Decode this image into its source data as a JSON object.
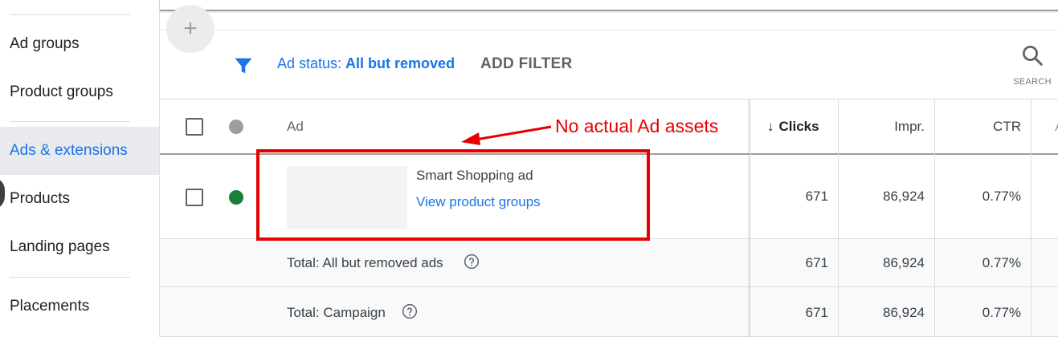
{
  "sidebar": {
    "items": [
      {
        "label": "Ad groups"
      },
      {
        "label": "Product groups"
      },
      {
        "label": "Ads & extensions"
      },
      {
        "label": "Products"
      },
      {
        "label": "Landing pages"
      },
      {
        "label": "Placements"
      }
    ]
  },
  "toolbar": {
    "add_symbol": "+",
    "filter_prefix": "Ad status: ",
    "filter_value": "All but removed",
    "add_filter": "ADD FILTER",
    "search_label": "SEARCH"
  },
  "table": {
    "headers": {
      "ad": "Ad",
      "clicks": "Clicks",
      "impr": "Impr.",
      "ctr": "CTR",
      "partial": "A"
    },
    "sort_arrow": "↓",
    "ad_row": {
      "title": "Smart Shopping ad",
      "link": "View product groups",
      "clicks": "671",
      "impr": "86,924",
      "ctr": "0.77%",
      "status_color": "#188038"
    },
    "totals": [
      {
        "label": "Total: All but removed ads",
        "clicks": "671",
        "impr": "86,924",
        "ctr": "0.77%"
      },
      {
        "label": "Total: Campaign",
        "clicks": "671",
        "impr": "86,924",
        "ctr": "0.77%"
      }
    ]
  },
  "annotation": {
    "text": "No actual Ad assets",
    "color": "#e60000"
  },
  "colors": {
    "accent": "#1a73e8",
    "active_bg": "#e8eaed",
    "status_enabled": "#188038",
    "status_header": "#9e9e9e"
  }
}
